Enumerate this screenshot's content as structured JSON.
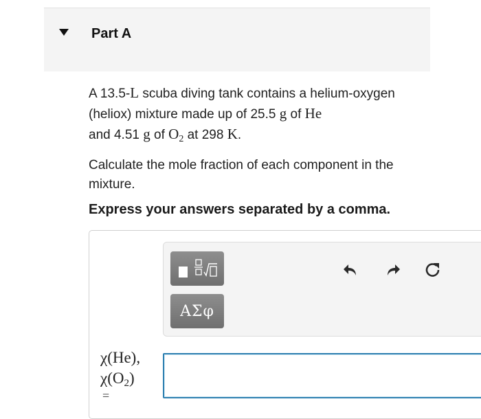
{
  "part": {
    "title": "Part A"
  },
  "problem": {
    "t1": "A 13.5-",
    "u1": "L",
    "t2": " scuba diving tank contains a helium-oxygen (heliox) mixture made up of 25.5 ",
    "u2": "g",
    "t3": " of ",
    "he": "He",
    "t4": " and 4.51 ",
    "u3": "g",
    "t5": " of ",
    "o": "O",
    "o_sub": "2",
    "t6": " at 298 ",
    "u4": "K",
    "t7": "."
  },
  "question": "Calculate the mole fraction of each component in the mixture.",
  "instruction": "Express your answers separated by a comma.",
  "toolbar": {
    "greek_label": "ΑΣφ",
    "icons": [
      "templates-icon",
      "undo-icon",
      "redo-icon",
      "reset-icon"
    ]
  },
  "answer": {
    "label_line1": "χ(He),",
    "label_chi": "χ(O",
    "label_sub": "2",
    "label_close": ")",
    "equals": "=",
    "value": ""
  },
  "colors": {
    "accent": "#2d7fb0",
    "button": "#7c7c7c",
    "header_bg": "#f4f4f4"
  }
}
